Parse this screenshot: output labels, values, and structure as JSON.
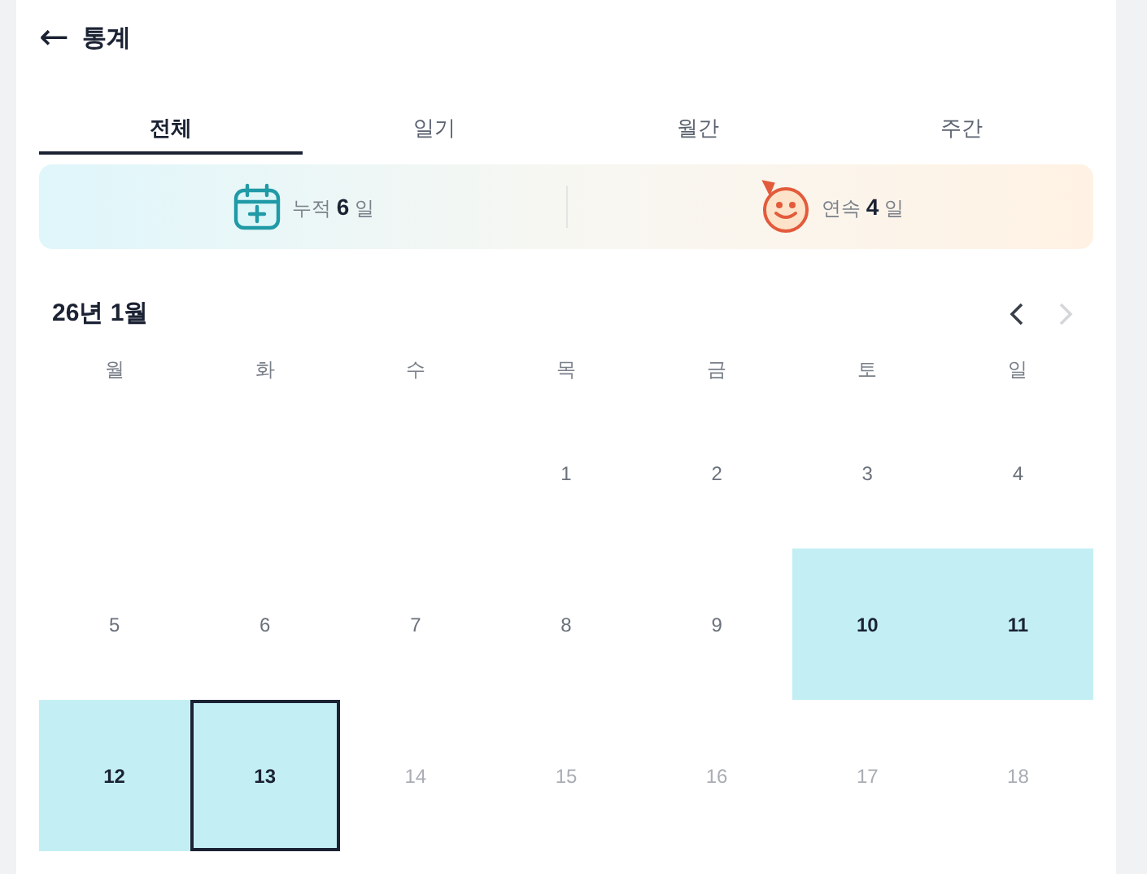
{
  "header": {
    "back": "←",
    "title": "통계"
  },
  "tabs": [
    {
      "label": "전체",
      "selected": true
    },
    {
      "label": "일기",
      "selected": false
    },
    {
      "label": "월간",
      "selected": false
    },
    {
      "label": "주간",
      "selected": false
    }
  ],
  "summary": [
    {
      "kind": "calendar",
      "label": "누적",
      "value": "6",
      "unit": "일"
    },
    {
      "kind": "smile",
      "label": "연속",
      "value": "4",
      "unit": "일"
    }
  ],
  "calendar": {
    "month": "26년 1월",
    "prev": {
      "disabled": false
    },
    "next": {
      "disabled": true
    },
    "weekdays": [
      "월",
      "화",
      "수",
      "목",
      "금",
      "토",
      "일"
    ],
    "days": [
      {
        "kind": "empty"
      },
      {
        "kind": "empty"
      },
      {
        "kind": "empty"
      },
      {
        "kind": "day",
        "text": "1",
        "recorded": false,
        "today": false,
        "future": false
      },
      {
        "kind": "day",
        "text": "2",
        "recorded": false,
        "today": false,
        "future": false
      },
      {
        "kind": "day",
        "text": "3",
        "recorded": false,
        "today": false,
        "future": false
      },
      {
        "kind": "day",
        "text": "4",
        "recorded": false,
        "today": false,
        "future": false
      },
      {
        "kind": "day",
        "text": "5",
        "recorded": false,
        "today": false,
        "future": false
      },
      {
        "kind": "day",
        "text": "6",
        "recorded": false,
        "today": false,
        "future": false
      },
      {
        "kind": "day",
        "text": "7",
        "recorded": false,
        "today": false,
        "future": false
      },
      {
        "kind": "day",
        "text": "8",
        "recorded": false,
        "today": false,
        "future": false
      },
      {
        "kind": "day",
        "text": "9",
        "recorded": false,
        "today": false,
        "future": false
      },
      {
        "kind": "day",
        "text": "10",
        "recorded": true,
        "today": false,
        "future": false
      },
      {
        "kind": "day",
        "text": "11",
        "recorded": true,
        "today": false,
        "future": false
      },
      {
        "kind": "day",
        "text": "12",
        "recorded": true,
        "today": false,
        "future": false
      },
      {
        "kind": "day",
        "text": "13",
        "recorded": true,
        "today": true,
        "future": false
      },
      {
        "kind": "day",
        "text": "14",
        "recorded": false,
        "today": false,
        "future": true
      },
      {
        "kind": "day",
        "text": "15",
        "recorded": false,
        "today": false,
        "future": true
      },
      {
        "kind": "day",
        "text": "16",
        "recorded": false,
        "today": false,
        "future": true
      },
      {
        "kind": "day",
        "text": "17",
        "recorded": false,
        "today": false,
        "future": true
      },
      {
        "kind": "day",
        "text": "18",
        "recorded": false,
        "today": false,
        "future": true
      }
    ]
  }
}
